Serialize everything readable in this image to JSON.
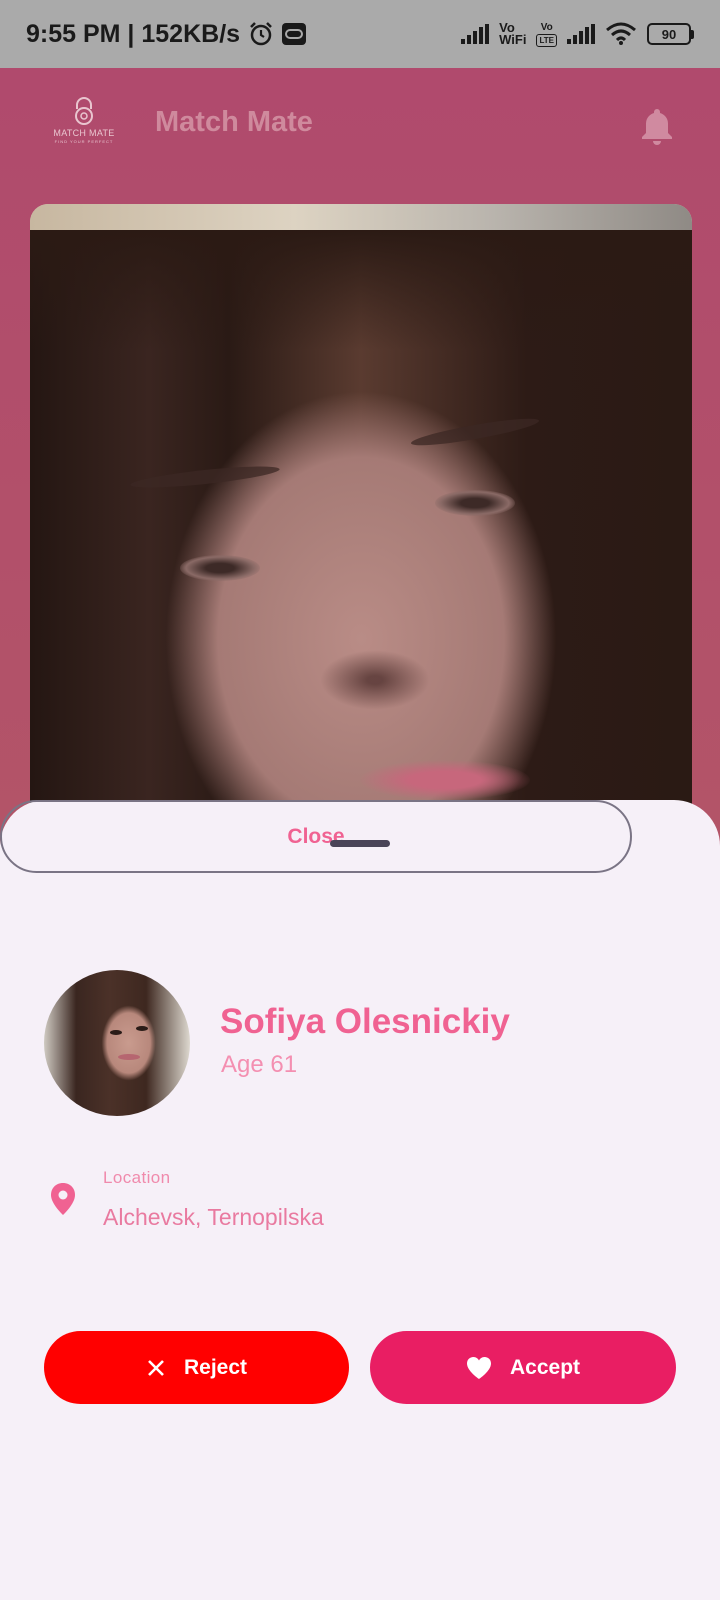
{
  "status_bar": {
    "time_speed": "9:55 PM | 152KB/s",
    "vo_wifi_top": "Vo",
    "vo_wifi_bottom": "WiFi",
    "vo_lte_top": "Vo",
    "vo_lte_bottom": "LTE",
    "battery": "90"
  },
  "app": {
    "logo_text": "MATCH MATE",
    "logo_subtext": "FIND YOUR PERFECT",
    "title": "Match Mate"
  },
  "profile": {
    "name": "Sofiya Olesnickiy",
    "age": "Age 61",
    "location_label": "Location",
    "location_value": "Alchevsk, Ternopilska"
  },
  "actions": {
    "reject_label": "Reject",
    "accept_label": "Accept",
    "close_label": "Close"
  },
  "colors": {
    "reject": "#ff0000",
    "accept": "#e91e63",
    "accent_text": "#f06292",
    "sheet_bg": "#f6f0f8"
  }
}
